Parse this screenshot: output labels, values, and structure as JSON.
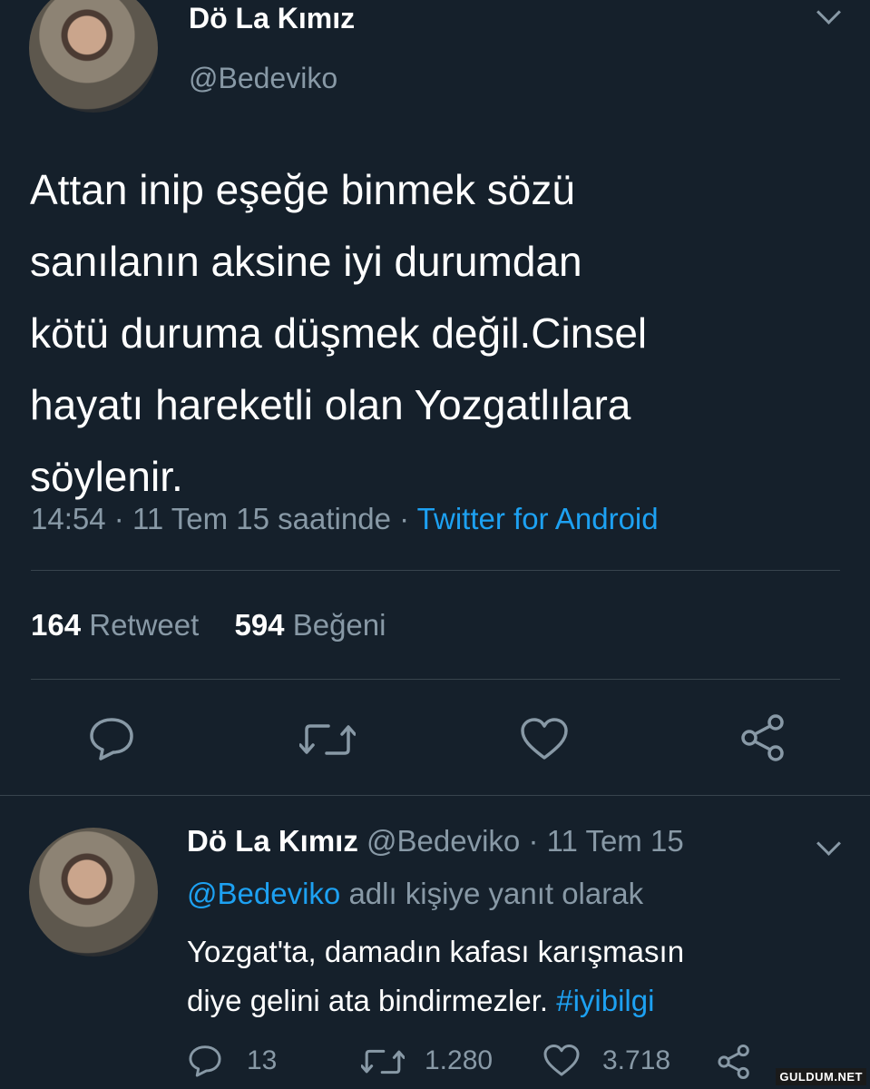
{
  "main_tweet": {
    "display_name": "Dö La Kımız",
    "handle": "@Bedeviko",
    "text_lines": [
      "Attan inip eşeğe binmek sözü",
      "sanılanın aksine iyi durumdan",
      "kötü duruma düşmek değil.Cinsel",
      "hayatı hareketli olan Yozgatlılara",
      "söylenir."
    ],
    "time": "14:54",
    "sep": "·",
    "date": "11 Tem 15 saatinde",
    "client": "Twitter for Android",
    "retweet_count": "164",
    "retweet_label": "Retweet",
    "like_count": "594",
    "like_label": "Beğeni",
    "actions": [
      "reply-icon",
      "retweet-icon",
      "like-icon",
      "share-icon"
    ]
  },
  "reply_tweet": {
    "display_name": "Dö La Kımız",
    "handle": "@Bedeviko",
    "meta": "· 11 Tem 15",
    "reply_to_handle": "@Bedeviko",
    "reply_to_suffix": "adlı kişiye yanıt olarak",
    "text_line1": "Yozgat'ta, damadın kafası karışmasın",
    "text_line2_prefix": "diye gelini ata bindirmezler.",
    "hashtag": "#iyibilgi",
    "reply_count": "13",
    "retweet_count": "1.280",
    "like_count": "3.718"
  },
  "watermark": "GULDUM.NET",
  "colors": {
    "background": "#15202b",
    "text": "#ffffff",
    "muted": "#8899a6",
    "link": "#1da1f2",
    "divider": "#38444d"
  }
}
